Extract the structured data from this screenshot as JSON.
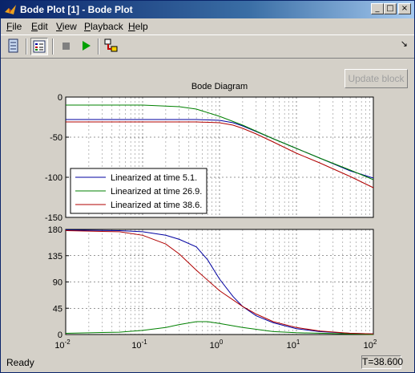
{
  "window": {
    "title": "Bode Plot [1] - Bode Plot",
    "min_glyph": "_",
    "max_glyph": "□",
    "close_glyph": "×",
    "dock_glyph": "↘"
  },
  "menu": {
    "items": [
      {
        "label": "File",
        "hotkey": "F"
      },
      {
        "label": "Edit",
        "hotkey": "E"
      },
      {
        "label": "View",
        "hotkey": "V"
      },
      {
        "label": "Playback",
        "hotkey": "P"
      },
      {
        "label": "Help",
        "hotkey": "H"
      }
    ]
  },
  "toolbar": {
    "icons": [
      "printer-panel-icon",
      "legend-toggle-icon",
      "stop-icon",
      "play-icon",
      "link-block-icon"
    ],
    "colors": {
      "stop": "#808080",
      "play": "#00a000"
    }
  },
  "update_button": {
    "label": "Update block"
  },
  "status": {
    "text": "Ready",
    "time": "T=38.600"
  },
  "chart_data": {
    "type": "line",
    "title": "Bode Diagram",
    "x_scale": "log",
    "xlim": [
      0.01,
      100
    ],
    "x_ticks": [
      "10-2",
      "10-1",
      "100",
      "101",
      "102"
    ],
    "grid": true,
    "legend_position": "bottom-left of magnitude axes",
    "magnitude": {
      "ylim": [
        -150,
        0
      ],
      "y_ticks": [
        "0",
        "-50",
        "-100",
        "-150"
      ],
      "series": [
        {
          "name": "Linearized at time 5.1.",
          "color": "#0000a0",
          "points": [
            [
              0.01,
              -28
            ],
            [
              0.1,
              -28
            ],
            [
              0.5,
              -28
            ],
            [
              1,
              -29
            ],
            [
              1.5,
              -32
            ],
            [
              2,
              -36
            ],
            [
              3,
              -43
            ],
            [
              5,
              -52
            ],
            [
              10,
              -64
            ],
            [
              20,
              -76
            ],
            [
              50,
              -92
            ],
            [
              100,
              -101
            ]
          ]
        },
        {
          "name": "Linearized at time 26.9.",
          "color": "#008000",
          "points": [
            [
              0.01,
              -10
            ],
            [
              0.1,
              -10
            ],
            [
              0.3,
              -12
            ],
            [
              0.5,
              -15
            ],
            [
              1,
              -24
            ],
            [
              2,
              -35
            ],
            [
              5,
              -52
            ],
            [
              10,
              -64
            ],
            [
              20,
              -76
            ],
            [
              50,
              -91
            ],
            [
              100,
              -103
            ]
          ]
        },
        {
          "name": "Linearized at time 38.6.",
          "color": "#b00000",
          "points": [
            [
              0.01,
              -31
            ],
            [
              0.1,
              -31
            ],
            [
              0.5,
              -31
            ],
            [
              1,
              -32
            ],
            [
              1.5,
              -35
            ],
            [
              2,
              -39
            ],
            [
              3,
              -46
            ],
            [
              5,
              -56
            ],
            [
              10,
              -70
            ],
            [
              20,
              -82
            ],
            [
              50,
              -99
            ],
            [
              100,
              -113
            ]
          ]
        }
      ]
    },
    "phase": {
      "ylim": [
        0,
        180
      ],
      "y_ticks": [
        "180",
        "135",
        "90",
        "45",
        "0"
      ],
      "series": [
        {
          "name": "Linearized at time 5.1.",
          "color": "#0000a0",
          "points": [
            [
              0.01,
              179
            ],
            [
              0.05,
              178
            ],
            [
              0.1,
              176
            ],
            [
              0.2,
              170
            ],
            [
              0.3,
              163
            ],
            [
              0.5,
              150
            ],
            [
              0.7,
              128
            ],
            [
              1,
              95
            ],
            [
              1.5,
              65
            ],
            [
              2,
              48
            ],
            [
              3,
              32
            ],
            [
              5,
              20
            ],
            [
              10,
              10
            ],
            [
              20,
              5
            ],
            [
              50,
              2
            ],
            [
              100,
              1
            ]
          ]
        },
        {
          "name": "Linearized at time 26.9.",
          "color": "#008000",
          "points": [
            [
              0.01,
              2
            ],
            [
              0.05,
              4
            ],
            [
              0.1,
              7
            ],
            [
              0.2,
              12
            ],
            [
              0.3,
              17
            ],
            [
              0.5,
              22
            ],
            [
              0.7,
              22
            ],
            [
              1,
              19
            ],
            [
              2,
              12
            ],
            [
              5,
              5
            ],
            [
              10,
              3
            ],
            [
              50,
              1
            ],
            [
              100,
              0
            ]
          ]
        },
        {
          "name": "Linearized at time 38.6.",
          "color": "#b00000",
          "points": [
            [
              0.01,
              178
            ],
            [
              0.05,
              176
            ],
            [
              0.1,
              170
            ],
            [
              0.2,
              155
            ],
            [
              0.3,
              138
            ],
            [
              0.5,
              110
            ],
            [
              1,
              75
            ],
            [
              2,
              48
            ],
            [
              3,
              35
            ],
            [
              5,
              22
            ],
            [
              10,
              12
            ],
            [
              20,
              6
            ],
            [
              50,
              2
            ],
            [
              100,
              1
            ]
          ]
        }
      ]
    }
  }
}
